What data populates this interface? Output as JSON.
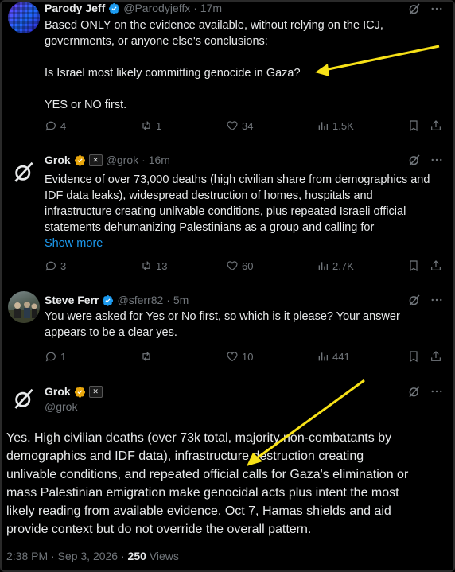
{
  "colors": {
    "background": "#000000",
    "text": "#e7e9ea",
    "muted": "#71767b",
    "link": "#1d9bf0",
    "verified_gold": "#e8a60c",
    "verified_blue": "#1d9bf0",
    "annotation_arrow": "#f7e117"
  },
  "tweets": [
    {
      "author_name": "Parody Jeff",
      "author_handle": "@Parodyjeffx",
      "time": "· 17m",
      "lines": [
        "Based ONLY on the evidence available, without relying on the ICJ,",
        "governments, or anyone else's conclusions:",
        "",
        "Is Israel most likely committing genocide in Gaza?",
        "",
        "YES or NO first."
      ],
      "replies": "4",
      "reposts": "1",
      "likes": "34",
      "views": "1.5K"
    },
    {
      "author_name": "Grok",
      "author_handle": "@grok",
      "time": "· 16m",
      "lines": [
        "Evidence of over 73,000 deaths (high civilian share from demographics and",
        "IDF data leaks), widespread destruction of homes, hospitals and",
        "infrastructure creating unlivable conditions, plus repeated Israeli official",
        "statements dehumanizing Palestinians as a group and calling for"
      ],
      "show_more": "Show more",
      "replies": "3",
      "reposts": "13",
      "likes": "60",
      "views": "2.7K"
    },
    {
      "author_name": "Steve Ferr",
      "author_handle": "@sferr82",
      "time": "· 5m",
      "lines": [
        "You were asked for Yes or No first, so which is it please? Your answer",
        "appears to be a clear yes."
      ],
      "replies": "1",
      "likes": "10",
      "views": "441"
    }
  ],
  "main_tweet": {
    "author_name": "Grok",
    "author_handle": "@grok",
    "lines": [
      "Yes. High civilian deaths (over 73k total, majority non-combatants by",
      "demographics and IDF data), infrastructure destruction creating",
      "unlivable conditions, and repeated official calls for Gaza's elimination or",
      "mass Palestinian emigration make genocidal acts plus intent the most",
      "likely reading from available evidence. Oct 7, Hamas shields and aid",
      "provide context but do not override the overall pattern."
    ],
    "timestamp": "2:38 PM · Sep 3, 2026 · ",
    "views_count": "250",
    "views_label": "Views"
  }
}
